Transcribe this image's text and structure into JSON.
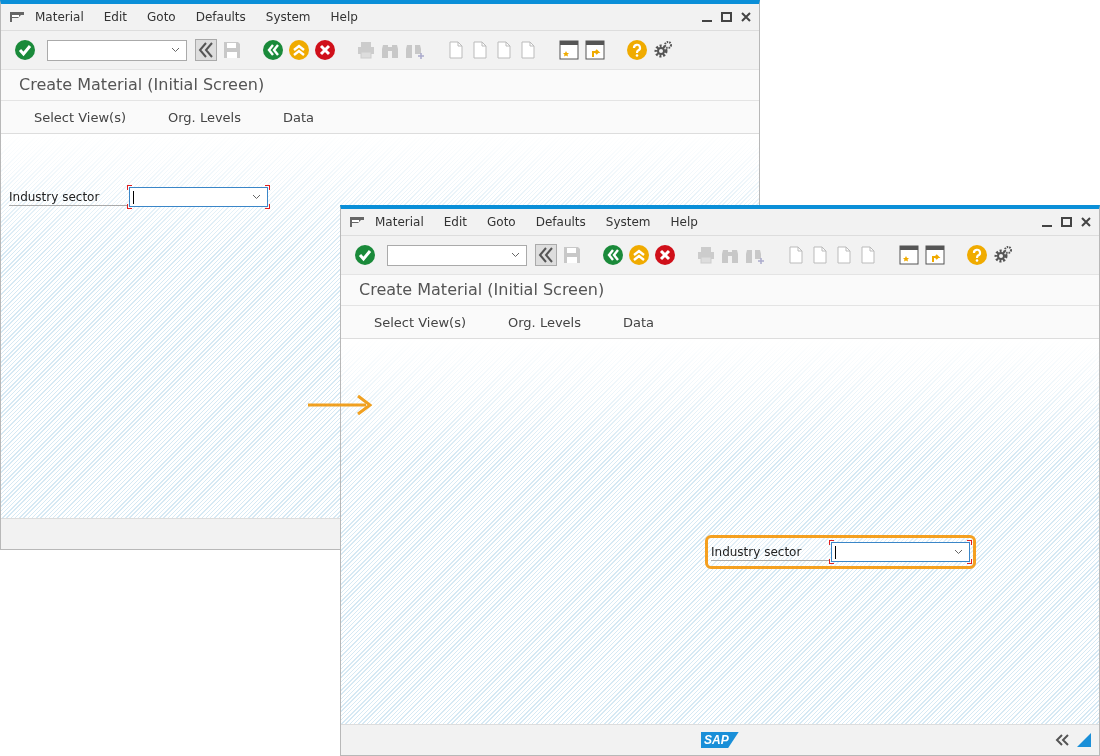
{
  "windows": [
    {
      "menu": [
        "Material",
        "Edit",
        "Goto",
        "Defaults",
        "System",
        "Help"
      ],
      "title": "Create Material (Initial Screen)",
      "app_toolbar": [
        "Select View(s)",
        "Org. Levels",
        "Data"
      ],
      "field": {
        "label": "Industry sector",
        "highlighted": false
      }
    },
    {
      "menu": [
        "Material",
        "Edit",
        "Goto",
        "Defaults",
        "System",
        "Help"
      ],
      "title": "Create Material (Initial Screen)",
      "app_toolbar": [
        "Select View(s)",
        "Org. Levels",
        "Data"
      ],
      "field": {
        "label": "Industry sector",
        "highlighted": true
      },
      "logo": "SAP"
    }
  ]
}
